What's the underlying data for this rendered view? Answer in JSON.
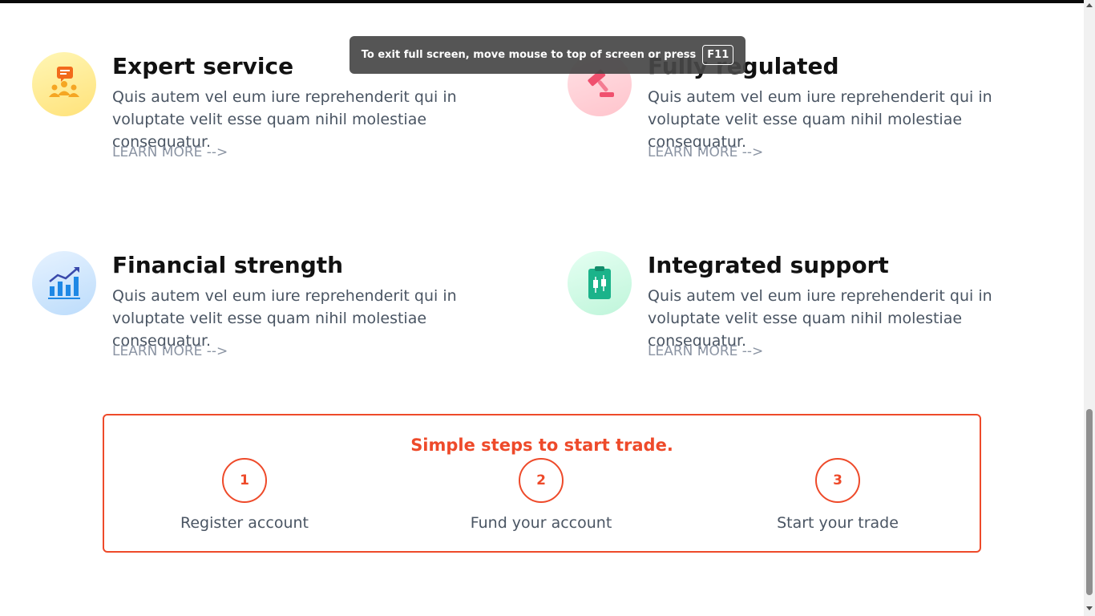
{
  "features": [
    {
      "title": "Expert service",
      "description": "Quis autem vel eum iure reprehenderit qui in voluptate velit esse quam nihil molestiae consequatur.",
      "link": "LEARN MORE -->",
      "icon": "team-chat-icon",
      "color": "#ffe27a"
    },
    {
      "title": "Fully regulated",
      "description": "Quis autem vel eum iure reprehenderit qui in voluptate velit esse quam nihil molestiae consequatur.",
      "link": "LEARN MORE -->",
      "icon": "gavel-icon",
      "color": "#ffc4cc"
    },
    {
      "title": "Financial strength",
      "description": "Quis autem vel eum iure reprehenderit qui in voluptate velit esse quam nihil molestiae consequatur.",
      "link": "LEARN MORE -->",
      "icon": "growth-chart-icon",
      "color": "#bcdcfb"
    },
    {
      "title": "Integrated support",
      "description": "Quis autem vel eum iure reprehenderit qui in voluptate velit esse quam nihil molestiae consequatur.",
      "link": "LEARN MORE -->",
      "icon": "clipboard-candlestick-icon",
      "color": "#bff5da"
    }
  ],
  "steps": {
    "title": "Simple steps to start trade.",
    "accent_color": "#ee4a2a",
    "items": [
      {
        "number": "1",
        "label": "Register account"
      },
      {
        "number": "2",
        "label": "Fund your account"
      },
      {
        "number": "3",
        "label": "Start your trade"
      }
    ]
  },
  "fullscreen_notice": {
    "text": "To exit full screen, move mouse to top of screen or press",
    "key": "F11"
  }
}
